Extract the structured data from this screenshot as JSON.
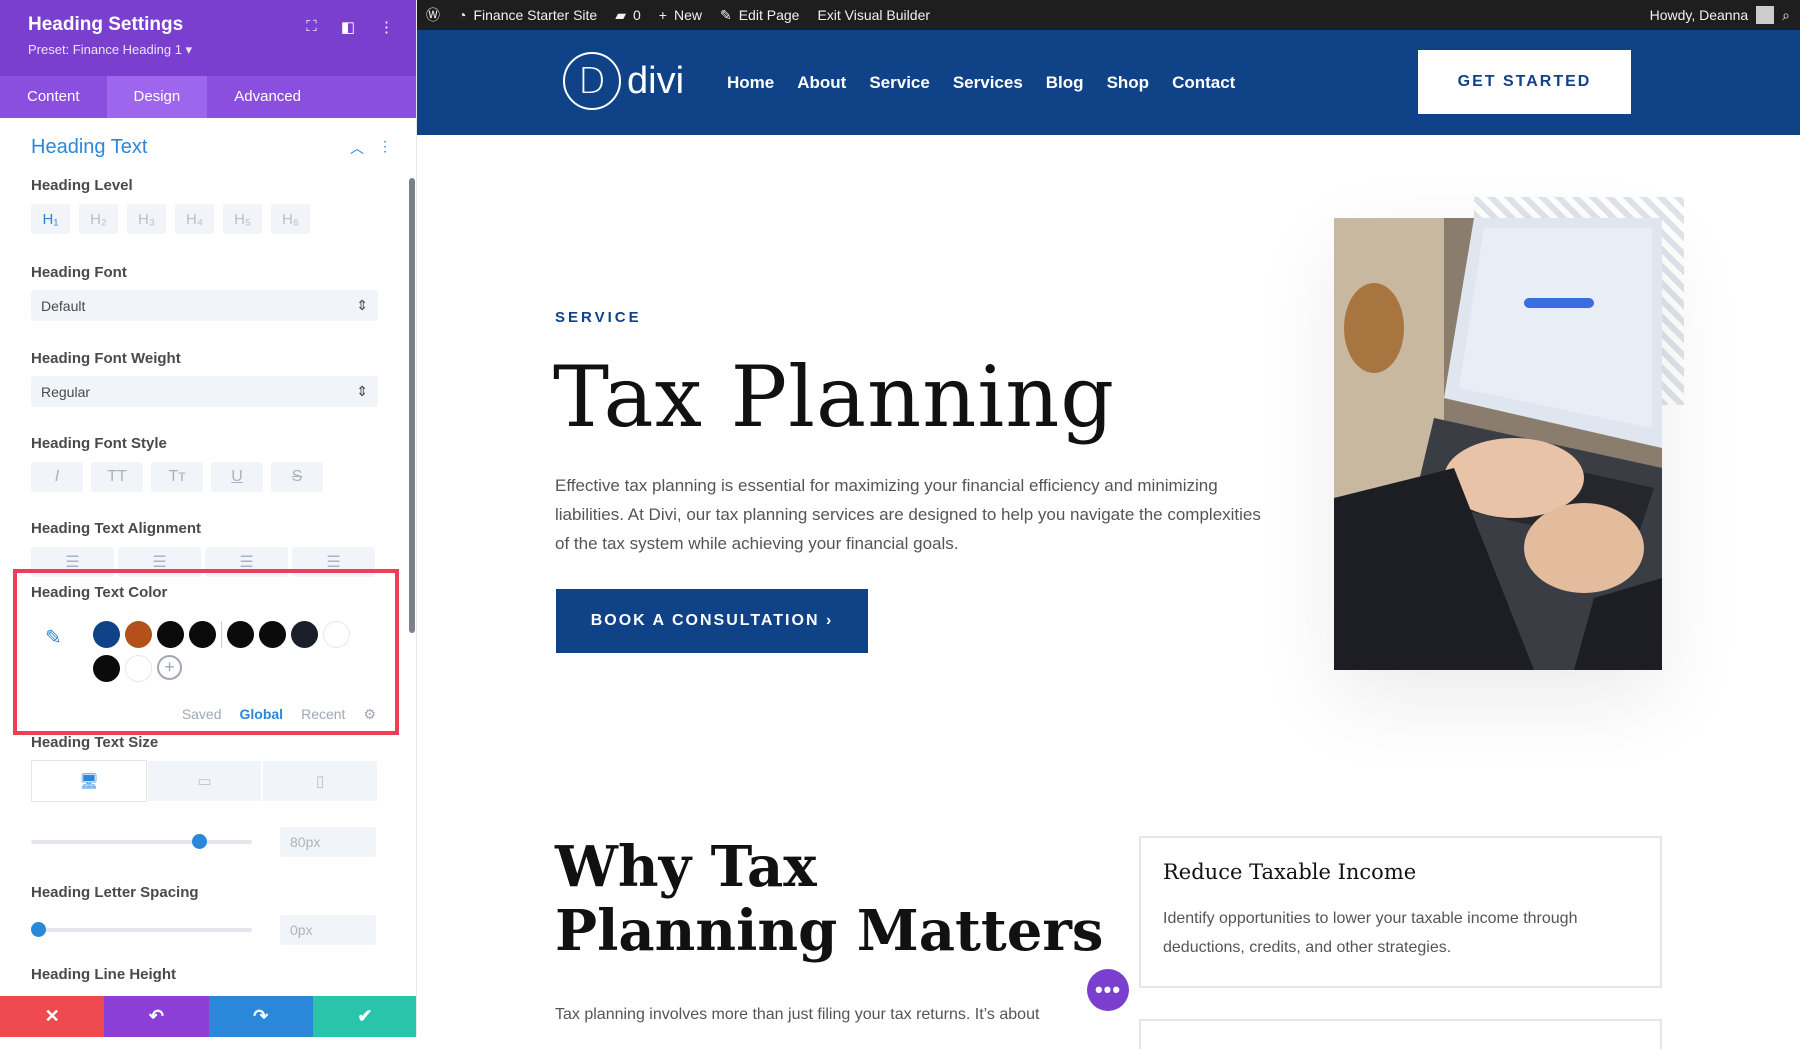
{
  "panel": {
    "title": "Heading Settings",
    "preset": "Preset: Finance Heading 1 ▾",
    "tabs": [
      "Content",
      "Design",
      "Advanced"
    ],
    "active_tab": "Design",
    "section_title": "Heading Text",
    "heading_level": {
      "label": "Heading Level",
      "levels": [
        "H₁",
        "H₂",
        "H₃",
        "H₄",
        "H₅",
        "H₆"
      ],
      "selected": "H₁"
    },
    "heading_font": {
      "label": "Heading Font",
      "value": "Default"
    },
    "heading_font_weight": {
      "label": "Heading Font Weight",
      "value": "Regular"
    },
    "heading_font_style": {
      "label": "Heading Font Style",
      "options": [
        "I",
        "TT",
        "Tт",
        "U",
        "S"
      ]
    },
    "heading_text_alignment": {
      "label": "Heading Text Alignment"
    },
    "heading_text_color": {
      "label": "Heading Text Color",
      "swatches": [
        "#104287",
        "#b3501c",
        "#0b0b0b",
        "#0b0b0b",
        "#0b0b0b",
        "#0b0b0b",
        "#1b1f2a",
        "#ffffff",
        "#0b0b0b",
        "#ffffff"
      ],
      "tabs": [
        "Saved",
        "Global",
        "Recent"
      ],
      "active_tab": "Global"
    },
    "heading_text_size": {
      "label": "Heading Text Size",
      "value": "80px",
      "level": 0.78
    },
    "heading_letter_spacing": {
      "label": "Heading Letter Spacing",
      "value": "0px",
      "level": 0.0
    },
    "heading_line_height": {
      "label": "Heading Line Height"
    },
    "footer": {
      "cancel": "✕",
      "undo": "↶",
      "redo": "↷",
      "save": "✔"
    }
  },
  "adminbar": {
    "site": "Finance Starter Site",
    "comments": "0",
    "new": "New",
    "edit": "Edit Page",
    "exit": "Exit Visual Builder",
    "howdy": "Howdy, Deanna"
  },
  "site": {
    "logo_letter": "D",
    "logo_text": "divi",
    "nav": [
      "Home",
      "About",
      "Service",
      "Services",
      "Blog",
      "Shop",
      "Contact"
    ],
    "cta": "GET STARTED"
  },
  "hero": {
    "eyebrow": "SERVICE",
    "title": "Tax Planning",
    "text": "Effective tax planning is essential for maximizing your financial efficiency and minimizing liabilities. At Divi, our tax planning services are designed to help you navigate the complexities of the tax system while achieving your financial goals.",
    "button": "BOOK A CONSULTATION ›"
  },
  "why": {
    "title": "Why Tax Planning Matters",
    "text": "Tax planning involves more than just filing your tax returns. It’s about",
    "card": {
      "title": "Reduce Taxable Income",
      "text": "Identify opportunities to lower your taxable income through deductions, credits, and other strategies."
    }
  },
  "colors": {
    "accent": "#7b3fcf",
    "brand": "#104287",
    "highlight": "#ee3f5a",
    "link": "#2b87da"
  }
}
